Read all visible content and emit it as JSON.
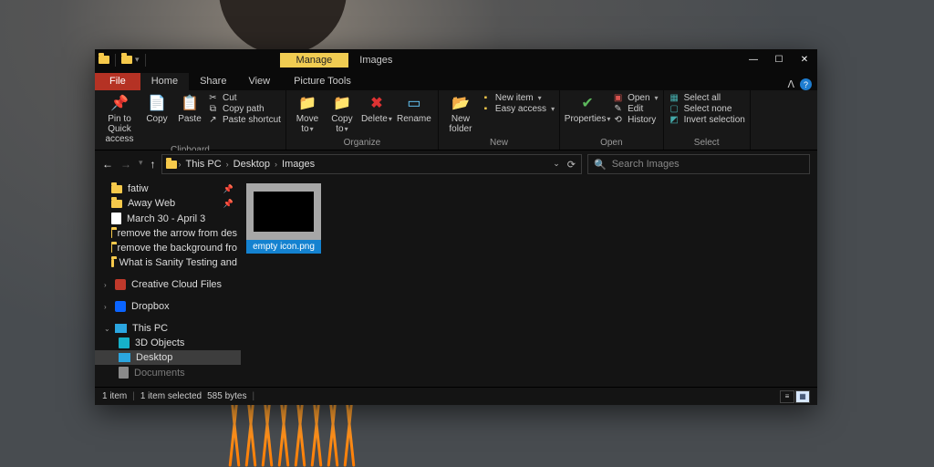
{
  "title_context": "Manage",
  "title": "Images",
  "tabs": {
    "file": "File",
    "home": "Home",
    "share": "Share",
    "view": "View",
    "context": "Picture Tools"
  },
  "ribbon": {
    "clipboard": {
      "label": "Clipboard",
      "pin": "Pin to Quick access",
      "copy": "Copy",
      "paste": "Paste",
      "cut": "Cut",
      "copy_path": "Copy path",
      "paste_shortcut": "Paste shortcut"
    },
    "organize": {
      "label": "Organize",
      "move": "Move to",
      "copy": "Copy to",
      "delete": "Delete",
      "rename": "Rename"
    },
    "new": {
      "label": "New",
      "folder": "New folder",
      "item": "New item",
      "easy": "Easy access"
    },
    "open": {
      "label": "Open",
      "props": "Properties",
      "open": "Open",
      "edit": "Edit",
      "history": "History"
    },
    "select": {
      "label": "Select",
      "all": "Select all",
      "none": "Select none",
      "invert": "Invert selection"
    }
  },
  "breadcrumb": [
    "This PC",
    "Desktop",
    "Images"
  ],
  "search_placeholder": "Search Images",
  "sidebar": {
    "items": [
      {
        "label": "fatiw",
        "icon": "folder",
        "pinned": true
      },
      {
        "label": "Away Web",
        "icon": "folder",
        "pinned": true
      },
      {
        "label": "March 30 - April 3",
        "icon": "doc"
      },
      {
        "label": "remove the arrow from des",
        "icon": "folder"
      },
      {
        "label": "remove the background fro",
        "icon": "folder"
      },
      {
        "label": "What is Sanity Testing and",
        "icon": "folder"
      }
    ],
    "creative_cloud": "Creative Cloud Files",
    "dropbox": "Dropbox",
    "this_pc": "This PC",
    "objects3d": "3D Objects",
    "desktop": "Desktop",
    "documents": "Documents"
  },
  "file": {
    "name": "empty icon.png"
  },
  "status": {
    "count": "1 item",
    "selected": "1 item selected",
    "size": "585 bytes"
  }
}
